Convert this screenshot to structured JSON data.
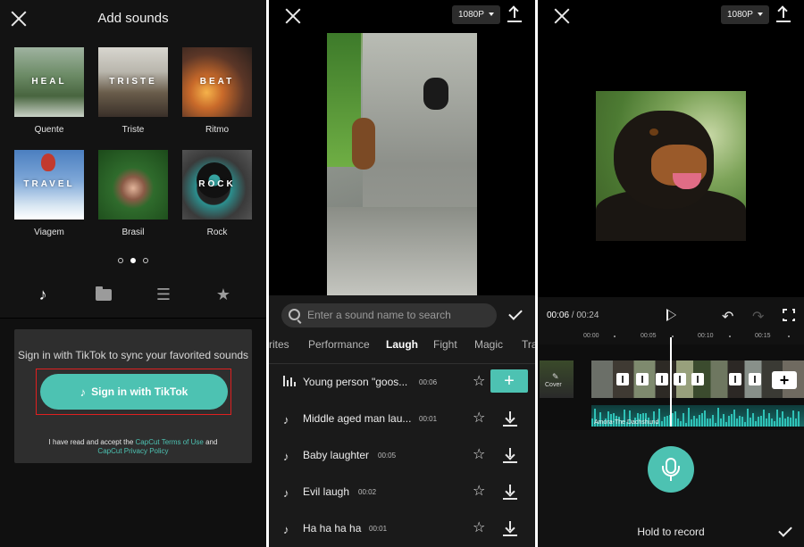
{
  "panel1": {
    "title": "Add sounds",
    "tiles": [
      {
        "word": "HEAL",
        "label": "Quente"
      },
      {
        "word": "TRISTE",
        "label": "Triste"
      },
      {
        "word": "BEAT",
        "label": "Ritmo"
      },
      {
        "word": "TRAVEL",
        "label": "Viagem"
      },
      {
        "word": "",
        "label": "Brasil"
      },
      {
        "word": "ROCK",
        "label": "Rock"
      }
    ],
    "pagination": {
      "pages": 3,
      "active": 2
    },
    "nav_icons": [
      "tiktok-icon",
      "folder-icon",
      "favorites-list-icon",
      "star-icon"
    ],
    "signin_prompt": "Sign in with TikTok to sync your favorited sounds",
    "signin_button": "Sign in with TikTok",
    "legal_prefix": "I have read and accept the",
    "legal_terms": "CapCut Terms of Use",
    "legal_and": "and",
    "legal_privacy": "CapCut Privacy Policy",
    "accent_color": "#4dc2b2",
    "highlight_color": "#e02020"
  },
  "panel2": {
    "resolution": "1080P",
    "search_placeholder": "Enter a sound name to search",
    "tabs": [
      "rites",
      "Performance",
      "Laugh",
      "Fight",
      "Magic",
      "Tra"
    ],
    "active_tab": "Laugh",
    "sounds": [
      {
        "name": "Young person \"goos...",
        "duration": "00:06",
        "playing": true
      },
      {
        "name": "Middle aged man lau...",
        "duration": "00:01",
        "playing": false
      },
      {
        "name": "Baby laughter",
        "duration": "00:05",
        "playing": false
      },
      {
        "name": "Evil laugh",
        "duration": "00:02",
        "playing": false
      },
      {
        "name": "Ha ha ha ha",
        "duration": "00:01",
        "playing": false
      }
    ],
    "add_label": "+"
  },
  "panel3": {
    "resolution": "1080P",
    "current_time": "00:06",
    "separator": " / ",
    "total_time": "00:24",
    "ruler": [
      "00:00",
      "00:05",
      "00:10",
      "00:15"
    ],
    "cover_label": "Cover",
    "audio_label": "Amora-The Dachshund",
    "plus": "+",
    "hold_label": "Hold to record"
  }
}
